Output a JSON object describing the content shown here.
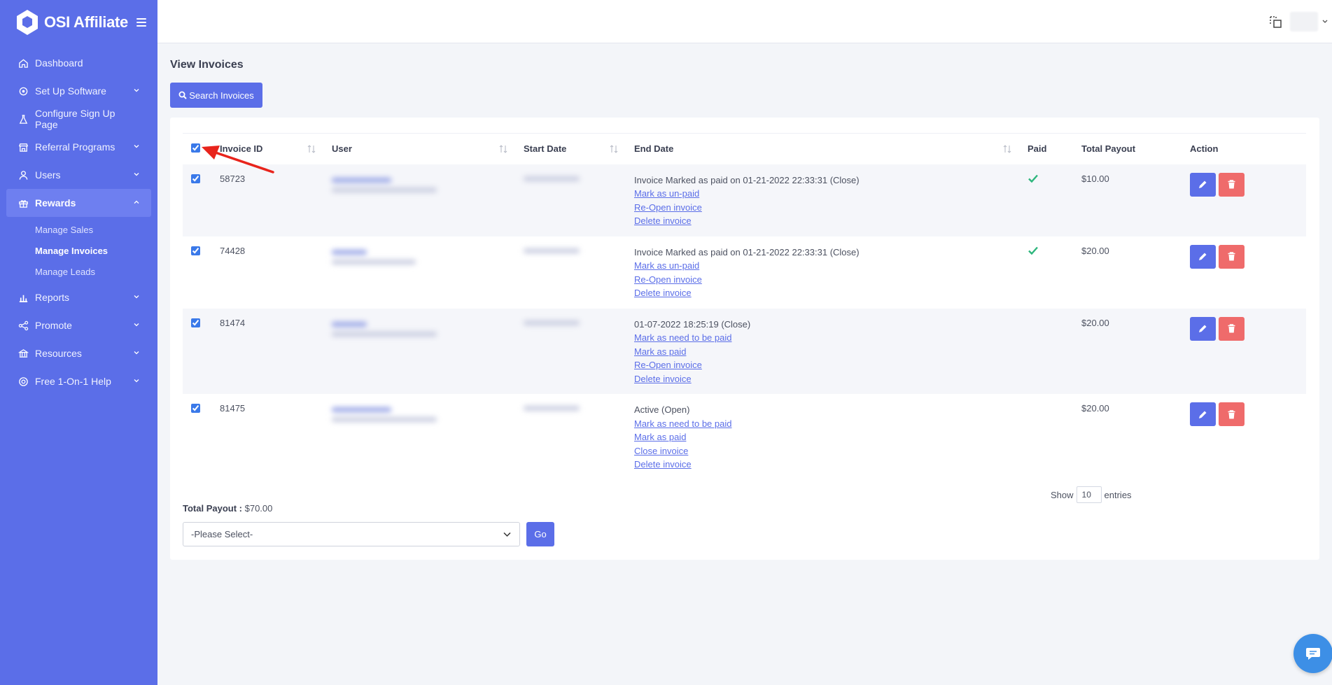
{
  "brand": {
    "name": "OSI Affiliate"
  },
  "colors": {
    "primary": "#5b6ee8",
    "danger": "#ef6b6b",
    "success": "#2eb67d",
    "link": "#5b6ee8"
  },
  "sidebar": {
    "items": [
      {
        "label": "Dashboard",
        "icon": "home-icon",
        "chevron": false
      },
      {
        "label": "Set Up Software",
        "icon": "gear-icon",
        "chevron": true
      },
      {
        "label": "Configure Sign Up Page",
        "icon": "flask-icon",
        "chevron": false
      },
      {
        "label": "Referral Programs",
        "icon": "store-icon",
        "chevron": true
      },
      {
        "label": "Users",
        "icon": "user-icon",
        "chevron": true
      },
      {
        "label": "Rewards",
        "icon": "gift-icon",
        "chevron": true,
        "expanded": true
      }
    ],
    "sub_items": [
      {
        "label": "Manage Sales"
      },
      {
        "label": "Manage Invoices",
        "active": true
      },
      {
        "label": "Manage Leads"
      }
    ],
    "items_after": [
      {
        "label": "Reports",
        "icon": "chart-icon"
      },
      {
        "label": "Promote",
        "icon": "share-icon"
      },
      {
        "label": "Resources",
        "icon": "bank-icon"
      },
      {
        "label": "Free 1-On-1 Help",
        "icon": "lifebuoy-icon"
      }
    ]
  },
  "page": {
    "title": "View Invoices",
    "search_button": "Search Invoices"
  },
  "table": {
    "columns": [
      "Invoice ID",
      "User",
      "Start Date",
      "End Date",
      "Paid",
      "Total Payout",
      "Action"
    ],
    "rows": [
      {
        "id": "58723",
        "status_text": "Invoice Marked as paid on 01-21-2022 22:33:31 (Close)",
        "links": [
          "Mark as un-paid",
          "Re-Open invoice",
          "Delete invoice"
        ],
        "paid": true,
        "payout": "$10.00"
      },
      {
        "id": "74428",
        "status_text": "Invoice Marked as paid on 01-21-2022 22:33:31 (Close)",
        "links": [
          "Mark as un-paid",
          "Re-Open invoice",
          "Delete invoice"
        ],
        "paid": true,
        "payout": "$20.00"
      },
      {
        "id": "81474",
        "status_text": "01-07-2022 18:25:19 (Close)",
        "links": [
          "Mark as need to be paid",
          "Mark as paid",
          "Re-Open invoice",
          "Delete invoice"
        ],
        "paid": false,
        "payout": "$20.00"
      },
      {
        "id": "81475",
        "status_text": "Active (Open)",
        "links": [
          "Mark as need to be paid",
          "Mark as paid",
          "Close invoice",
          "Delete invoice"
        ],
        "paid": false,
        "payout": "$20.00"
      }
    ]
  },
  "footer": {
    "show_label": "Show",
    "entries_value": "10",
    "entries_label": "entries",
    "total_label": "Total Payout :",
    "total_value": "$70.00",
    "select_placeholder": "-Please Select-",
    "go_label": "Go"
  }
}
